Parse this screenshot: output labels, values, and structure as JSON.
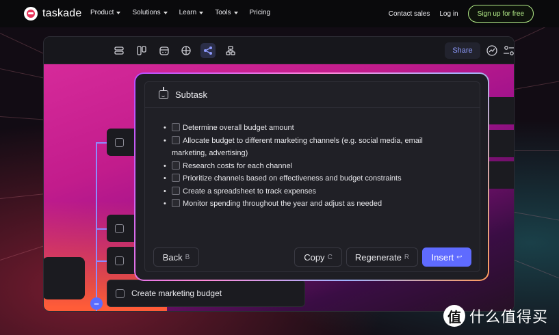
{
  "nav": {
    "brand": "taskade",
    "menu": [
      {
        "label": "Product",
        "has_caret": true
      },
      {
        "label": "Solutions",
        "has_caret": true
      },
      {
        "label": "Learn",
        "has_caret": true
      },
      {
        "label": "Tools",
        "has_caret": true
      },
      {
        "label": "Pricing",
        "has_caret": false
      }
    ],
    "contact_sales": "Contact sales",
    "login": "Log in",
    "signup": "Sign up for free"
  },
  "toolbar": {
    "share": "Share",
    "view_icons": [
      "list-view-icon",
      "board-view-icon",
      "calendar-view-icon",
      "table-view-icon",
      "mindmap-view-icon",
      "org-chart-view-icon"
    ],
    "active_view": "mindmap-view-icon"
  },
  "canvas": {
    "focused_node": "Create marketing budget"
  },
  "modal": {
    "title": "Subtask",
    "tasks": [
      "Determine overall budget amount",
      "Allocate budget to different marketing channels (e.g. social media, email marketing, advertising)",
      "Research costs for each channel",
      "Prioritize channels based on effectiveness and budget constraints",
      "Create a spreadsheet to track expenses",
      "Monitor spending throughout the year and adjust as needed"
    ],
    "buttons": {
      "back": {
        "label": "Back",
        "key": "B"
      },
      "copy": {
        "label": "Copy",
        "key": "C"
      },
      "regenerate": {
        "label": "Regenerate",
        "key": "R"
      },
      "insert": {
        "label": "Insert",
        "key": "↩"
      }
    }
  },
  "watermark": {
    "symbol": "值",
    "text": "什么值得买"
  },
  "colors": {
    "accent": "#5f6bff",
    "signup_green": "#b6f08a",
    "share_text": "#8f9bff"
  }
}
